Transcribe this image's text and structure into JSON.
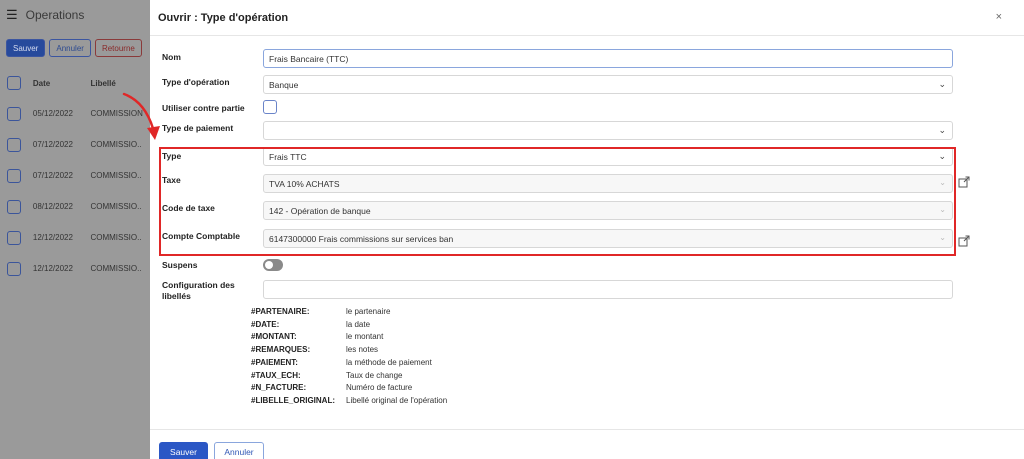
{
  "background": {
    "title": "Operations",
    "buttons": {
      "save": "Sauver",
      "cancel": "Annuler",
      "back": "Retourne"
    },
    "columns": {
      "date": "Date",
      "label": "Libellé"
    },
    "rows": [
      {
        "date": "05/12/2022",
        "label": "COMMISSION"
      },
      {
        "date": "07/12/2022",
        "label": "COMMISSIO.."
      },
      {
        "date": "07/12/2022",
        "label": "COMMISSIO.."
      },
      {
        "date": "08/12/2022",
        "label": "COMMISSIO.."
      },
      {
        "date": "12/12/2022",
        "label": "COMMISSIO.."
      },
      {
        "date": "12/12/2022",
        "label": "COMMISSIO.."
      }
    ]
  },
  "modal": {
    "title": "Ouvrir : Type d'opération",
    "close": "×",
    "fields": {
      "nom": {
        "label": "Nom",
        "value": "Frais Bancaire (TTC)"
      },
      "type_operation": {
        "label": "Type d'opération",
        "value": "Banque"
      },
      "contre_partie": {
        "label": "Utiliser contre partie"
      },
      "type_paiement": {
        "label": "Type de paiement",
        "value": ""
      },
      "type": {
        "label": "Type",
        "value": "Frais TTC"
      },
      "taxe": {
        "label": "Taxe",
        "value": "TVA 10% ACHATS"
      },
      "code_taxe": {
        "label": "Code de taxe",
        "value": "142 - Opération de banque"
      },
      "compte": {
        "label": "Compte Comptable",
        "value": "6147300000 Frais commissions sur services ban"
      },
      "suspens": {
        "label": "Suspens"
      },
      "config": {
        "label": "Configuration des libellés",
        "value": ""
      }
    },
    "help": [
      {
        "key": "#PARTENAIRE:",
        "desc": "le partenaire"
      },
      {
        "key": "#DATE:",
        "desc": "la date"
      },
      {
        "key": "#MONTANT:",
        "desc": "le montant"
      },
      {
        "key": "#REMARQUES:",
        "desc": "les notes"
      },
      {
        "key": "#PAIEMENT:",
        "desc": "la méthode de paiement"
      },
      {
        "key": "#TAUX_ECH:",
        "desc": "Taux de change"
      },
      {
        "key": "#N_FACTURE:",
        "desc": "Numéro de facture"
      },
      {
        "key": "#LIBELLE_ORIGINAL:",
        "desc": "Libellé original de l'opération"
      }
    ],
    "footer": {
      "save": "Sauver",
      "cancel": "Annuler"
    }
  },
  "colors": {
    "primary": "#2b57c5",
    "highlight": "#e02727"
  }
}
